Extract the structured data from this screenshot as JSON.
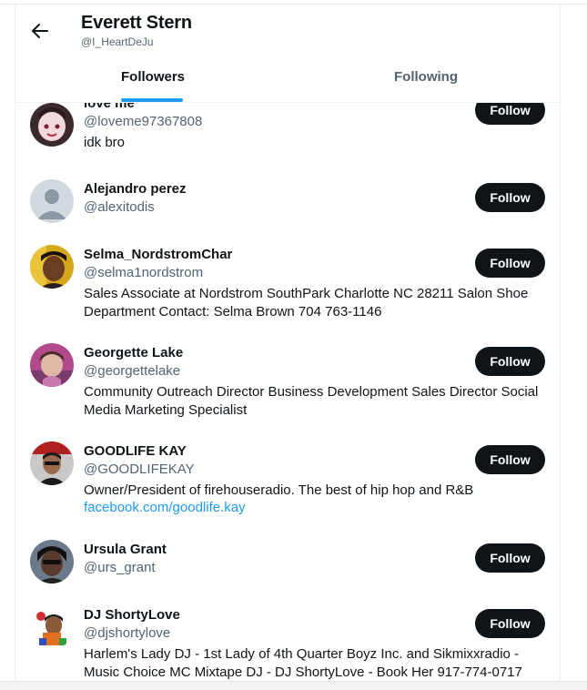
{
  "header": {
    "title": "Everett Stern",
    "handle": "@I_HeartDeJu"
  },
  "tabs": [
    {
      "label": "Followers",
      "active": true
    },
    {
      "label": "Following",
      "active": false
    }
  ],
  "colors": {
    "accent": "#1d9bf0",
    "text": "#0f1419",
    "muted": "#536471",
    "button_bg": "#0f1419"
  },
  "followers": [
    {
      "name": "love me",
      "handle": "@loveme97367808",
      "bio": "idk bro",
      "button": "Follow",
      "avatar_icon": "photo-avatar-icon"
    },
    {
      "name": "Alejandro perez",
      "handle": "@alexitodis",
      "bio": "",
      "button": "Follow",
      "avatar_icon": "default-avatar-icon"
    },
    {
      "name": "Selma_NordstromChar",
      "handle": "@selma1nordstrom",
      "bio": "Sales Associate at Nordstrom SouthPark Charlotte NC 28211 Salon Shoe Department Contact: Selma Brown 704 763-1146",
      "button": "Follow",
      "avatar_icon": "photo-avatar-icon"
    },
    {
      "name": "Georgette Lake",
      "handle": "@georgettelake",
      "bio": "Community Outreach Director Business Development Sales Director Social Media Marketing Specialist",
      "button": "Follow",
      "avatar_icon": "photo-avatar-icon"
    },
    {
      "name": "GOODLIFE KAY",
      "handle": "@GOODLIFEKAY",
      "bio": "Owner/President of firehouseradio. The best of hip hop and R&B",
      "link": "facebook.com/goodlife.kay",
      "button": "Follow",
      "avatar_icon": "photo-avatar-icon"
    },
    {
      "name": "Ursula Grant",
      "handle": "@urs_grant",
      "bio": "",
      "button": "Follow",
      "avatar_icon": "photo-avatar-icon"
    },
    {
      "name": "DJ ShortyLove",
      "handle": "@djshortylove",
      "bio": "Harlem's Lady DJ - 1st Lady of 4th Quarter Boyz Inc. and Sikmixxradio - Music Choice MC Mixtape DJ - DJ ShortyLove - Book Her 917-774-0717",
      "button": "Follow",
      "avatar_icon": "photo-avatar-icon"
    }
  ]
}
